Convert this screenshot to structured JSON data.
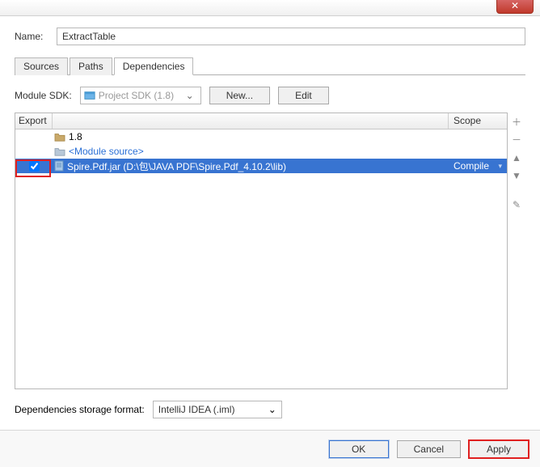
{
  "name_label": "Name:",
  "name_value": "ExtractTable",
  "tabs": {
    "sources": "Sources",
    "paths": "Paths",
    "dependencies": "Dependencies"
  },
  "sdk": {
    "label": "Module SDK:",
    "value": "Project SDK (1.8)",
    "new_btn": "New...",
    "edit_btn": "Edit"
  },
  "columns": {
    "export": "Export",
    "scope": "Scope"
  },
  "deps": [
    {
      "label": "1.8",
      "kind": "folder"
    },
    {
      "label": "<Module source>",
      "kind": "folder-link"
    },
    {
      "label": "Spire.Pdf.jar (D:\\包\\JAVA PDF\\Spire.Pdf_4.10.2\\lib)",
      "kind": "jar",
      "scope": "Compile",
      "checked": true,
      "selected": true
    }
  ],
  "storage": {
    "label": "Dependencies storage format:",
    "value": "IntelliJ IDEA (.iml)"
  },
  "buttons": {
    "ok": "OK",
    "cancel": "Cancel",
    "apply": "Apply"
  }
}
